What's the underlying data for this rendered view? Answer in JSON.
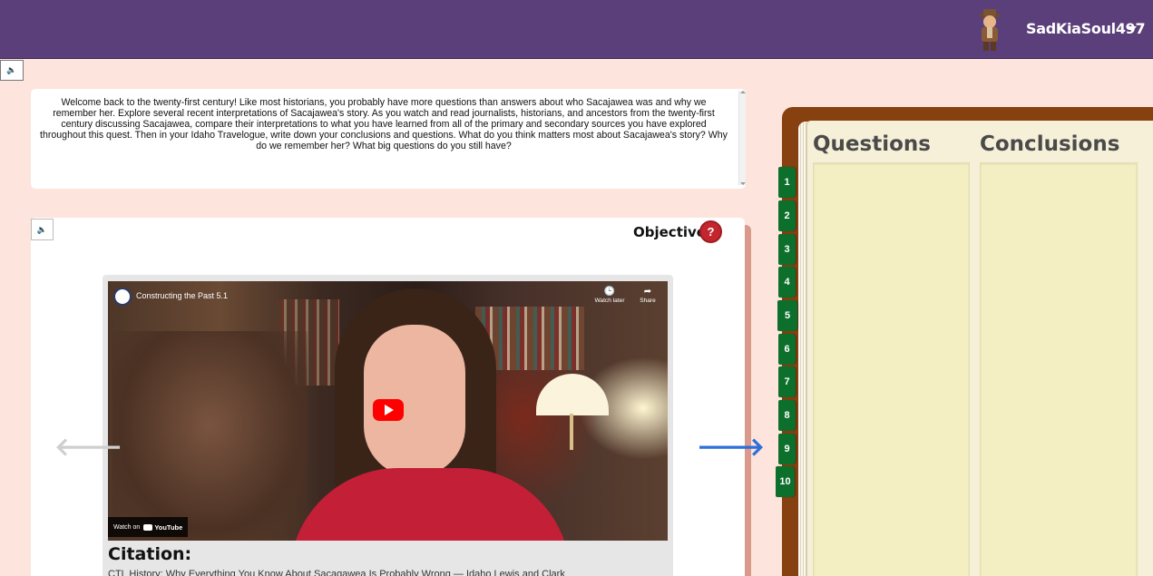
{
  "header": {
    "username": "SadKiaSoul497",
    "avatar_icon": "explorer-avatar-icon",
    "dropdown_icon": "caret-down-icon",
    "bar_color": "#5b3f7a"
  },
  "audio": {
    "icon": "speaker-icon",
    "glyph": "🔈"
  },
  "intro": {
    "text": "Welcome back to the twenty-first century! Like most historians, you probably have more questions than answers about who Sacajawea was and why we remember her. Explore several recent interpretations of Sacajawea's story. As you watch and read journalists, historians, and ancestors from the twenty-first century discussing Sacajawea, compare their interpretations to what you have learned from all of the primary and secondary sources you have explored throughout this quest. Then in your Idaho Travelogue, write down your conclusions and questions. What do you think matters most about Sacajawea's story? Why do we remember her? What big questions do you still have?"
  },
  "objective": {
    "label": "Objective",
    "help_glyph": "?",
    "help_color": "#c4262e"
  },
  "video": {
    "title": "Constructing the Past 5.1",
    "watch_later": "Watch later",
    "watch_later_glyph": "🕒",
    "share": "Share",
    "share_glyph": "➦",
    "watch_on": "Watch on",
    "youtube": "YouTube"
  },
  "citation": {
    "heading": "Citation:",
    "text": "CTL History: Why Everything You Know About Sacagawea Is Probably Wrong — Idaho Lewis and Clark"
  },
  "nav": {
    "prev_glyph": "🡐",
    "next_glyph": "🡒",
    "prev_color": "#cfcfcf",
    "next_color": "#2f6fd8"
  },
  "travelogue": {
    "questions_heading": "Questions",
    "conclusions_heading": "Conclusions",
    "tabs": [
      "1",
      "2",
      "3",
      "4",
      "5",
      "6",
      "7",
      "8",
      "9",
      "10"
    ],
    "tab_color": "#0d6f2c",
    "cover_color": "#87400f"
  }
}
